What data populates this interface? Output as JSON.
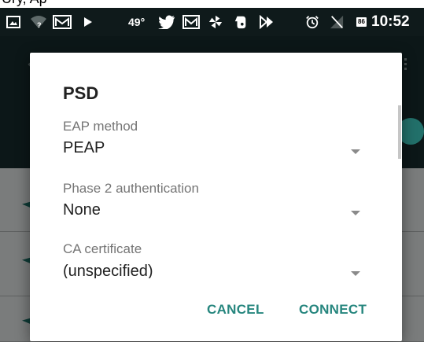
{
  "caption": {
    "partial_text": "Ury, Ap"
  },
  "status_bar": {
    "temperature": "49°",
    "time": "10:52",
    "battery_level": "86",
    "icons": [
      "screenshot-icon",
      "wifi-unknown-icon",
      "gmail-icon",
      "play-icon",
      "twitter-icon",
      "gmail-icon",
      "pinwheel-icon",
      "evernote-icon",
      "sync-icon",
      "alarm-icon",
      "no-signal-icon",
      "battery-icon"
    ]
  },
  "dialog": {
    "title": "PSD",
    "fields": [
      {
        "label": "EAP method",
        "value": "PEAP"
      },
      {
        "label": "Phase 2 authentication",
        "value": "None"
      },
      {
        "label": "CA certificate",
        "value": "(unspecified)"
      }
    ],
    "buttons": {
      "cancel": "CANCEL",
      "connect": "CONNECT"
    }
  },
  "colors": {
    "accent": "#26867e",
    "status_bar": "#0f1a1b",
    "dialog_bg": "#ffffff",
    "label_text": "#757575",
    "value_text": "#212121"
  }
}
